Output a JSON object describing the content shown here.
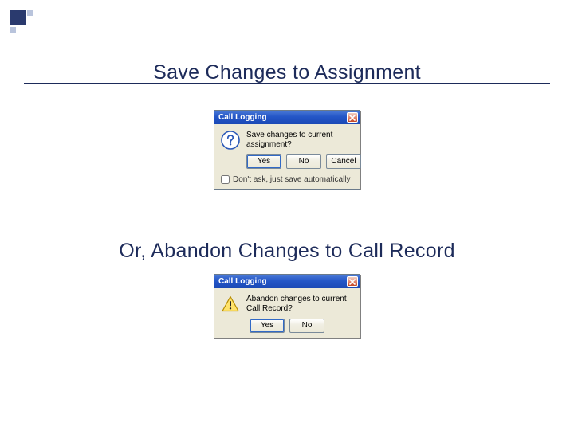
{
  "slide": {
    "heading1": "Save Changes to Assignment",
    "heading2": "Or, Abandon Changes to Call Record"
  },
  "dialog1": {
    "title": "Call Logging",
    "message": "Save changes to current assignment?",
    "buttons": {
      "yes": "Yes",
      "no": "No",
      "cancel": "Cancel"
    },
    "checkbox_label": "Don't ask, just save automatically"
  },
  "dialog2": {
    "title": "Call Logging",
    "message": "Abandon changes to current Call Record?",
    "buttons": {
      "yes": "Yes",
      "no": "No"
    }
  }
}
